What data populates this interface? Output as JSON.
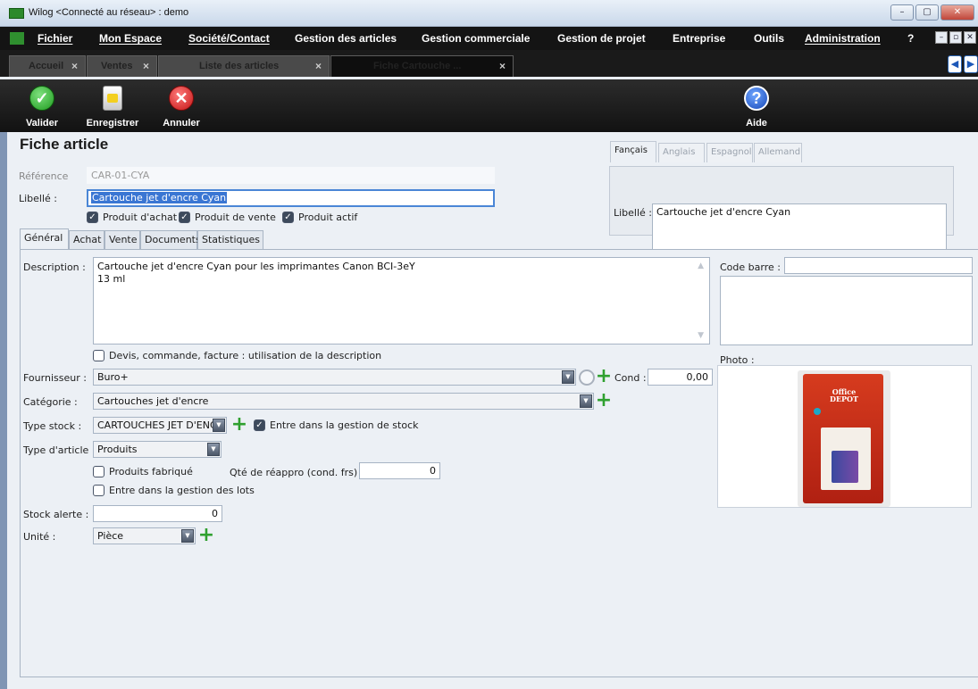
{
  "window": {
    "title": "Wilog <Connecté au réseau> : demo",
    "buttons": [
      "–",
      "▢",
      "✕"
    ]
  },
  "menu": {
    "items": [
      "Fichier",
      "Mon Espace",
      "Société/Contact",
      "Gestion des articles",
      "Gestion commerciale",
      "Gestion de projet",
      "Entreprise",
      "Outils",
      "Administration",
      "?"
    ],
    "mdi_buttons": [
      "–",
      "▫",
      "✕"
    ]
  },
  "tabs": [
    {
      "label": "Accueil",
      "close": "×"
    },
    {
      "label": "Ventes",
      "close": "×"
    },
    {
      "label": "Liste des articles",
      "close": "×"
    },
    {
      "label": "Fiche Cartouche ...",
      "close": "×"
    }
  ],
  "nav_arrows": [
    "◀",
    "▶"
  ],
  "toolbar": {
    "valider": "Valider",
    "enregistrer": "Enregistrer",
    "annuler": "Annuler",
    "aide": "Aide",
    "valider_glyph": "✓",
    "annuler_glyph": "✕",
    "aide_glyph": "?"
  },
  "form": {
    "title": "Fiche article",
    "reference_label": "Référence",
    "reference_value": "CAR-01-CYA",
    "libelle_label": "Libellé :",
    "libelle_value": "Cartouche jet d'encre Cyan",
    "checks": [
      {
        "label": "Produit d'achat",
        "checked": true
      },
      {
        "label": "Produit de vente",
        "checked": true
      },
      {
        "label": "Produit actif",
        "checked": true
      }
    ],
    "check_glyph": "✓"
  },
  "lang": {
    "tabs": [
      "Fançais",
      "Anglais",
      "Espagnol",
      "Allemand"
    ],
    "libelle_label": "Libellé :",
    "libelle_value": "Cartouche jet d'encre Cyan"
  },
  "inner_tabs": [
    "Général",
    "Achat",
    "Vente",
    "Documents",
    "Statistiques"
  ],
  "general": {
    "description_label": "Description :",
    "description_lines": [
      "Cartouche jet d'encre Cyan  pour les imprimantes Canon BCI-3eY",
      "13 ml"
    ],
    "use_description": "Devis, commande, facture : utilisation de la description",
    "fournisseur_label": "Fournisseur :",
    "fournisseur_value": "Buro+",
    "cond_label": "Cond :",
    "cond_value": "0,00",
    "categorie_label": "Catégorie :",
    "categorie_value": "Cartouches jet d'encre",
    "type_stock_label": "Type stock :",
    "type_stock_value": "CARTOUCHES JET D'ENCR",
    "gestion_stock": "Entre dans la gestion de stock",
    "type_article_label": "Type d'article :",
    "type_article_value": "Produits",
    "produits_fabriques": "Produits fabriqué",
    "qte_reappro_label": "Qté de réappro (cond. frs) :",
    "qte_reappro_value": "0",
    "gestion_lots": "Entre dans la gestion des lots",
    "stock_alerte_label": "Stock alerte :",
    "stock_alerte_value": "0",
    "unite_label": "Unité :",
    "unite_value": "Pièce",
    "code_barre_label": "Code barre :",
    "code_barre_value": "",
    "photo_label": "Photo :",
    "product_brand": "Office DEPOT"
  }
}
